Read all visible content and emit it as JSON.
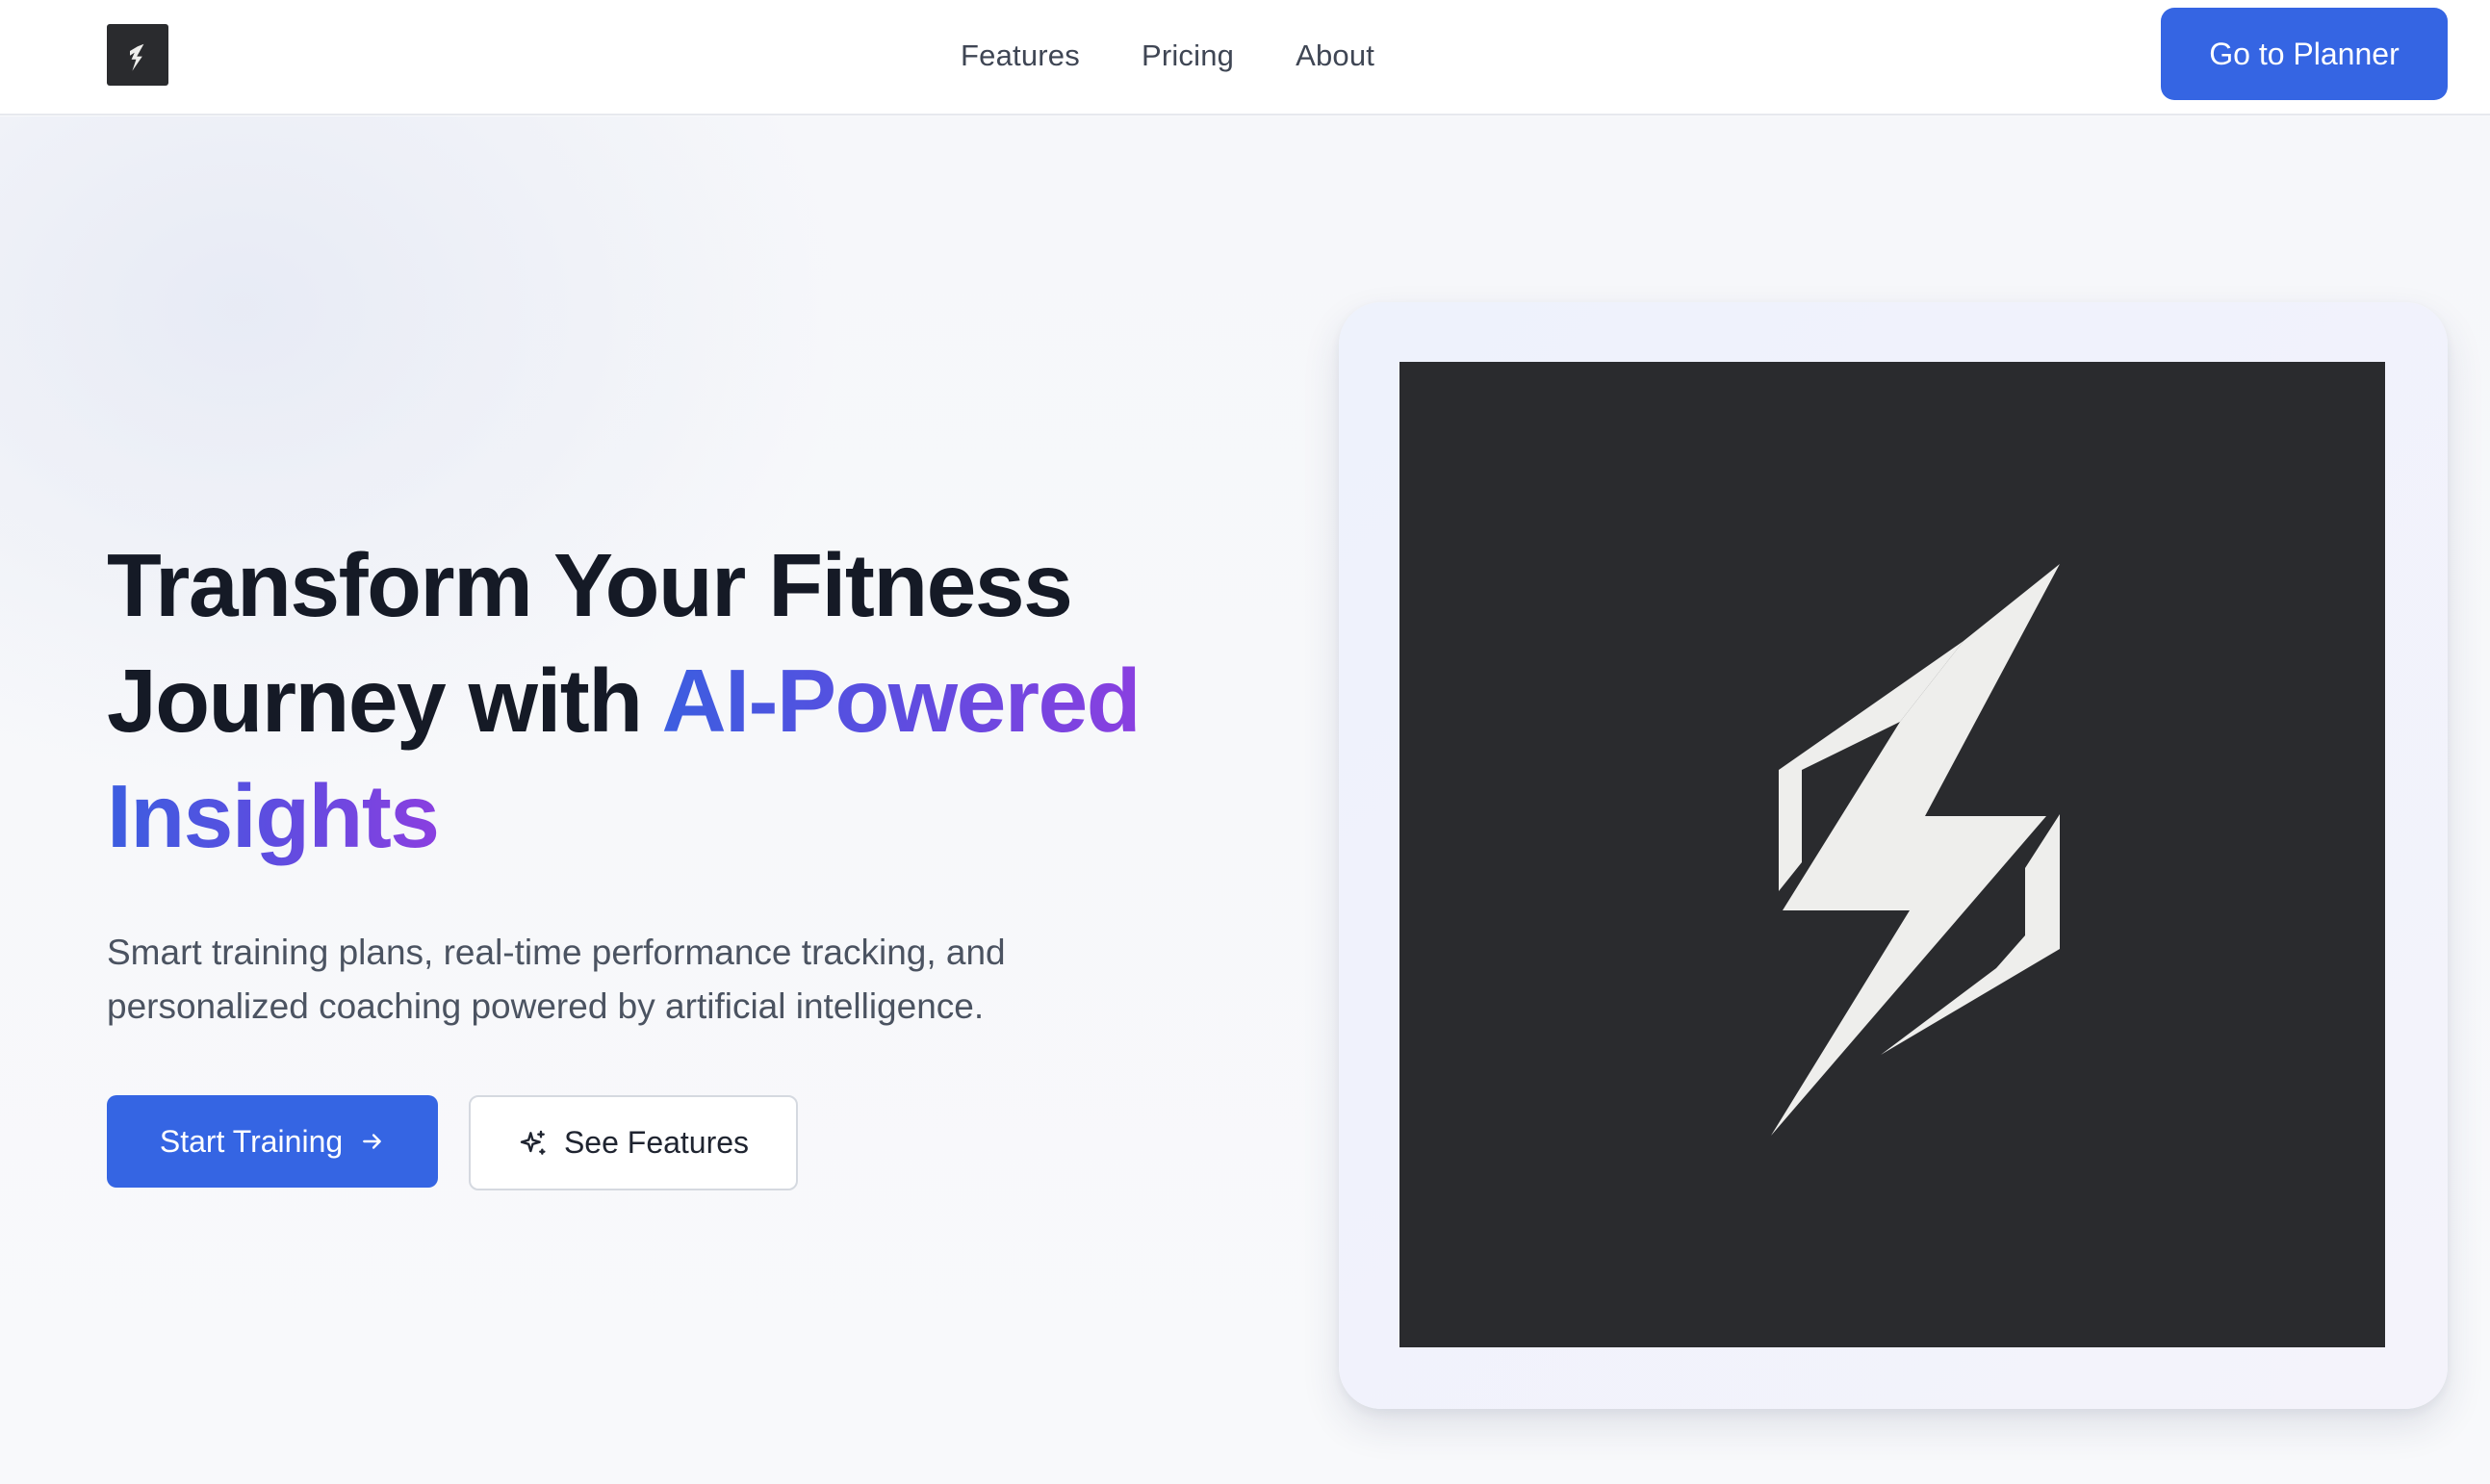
{
  "header": {
    "logo_icon": "lightning-bolt-icon",
    "nav": [
      {
        "label": "Features"
      },
      {
        "label": "Pricing"
      },
      {
        "label": "About"
      }
    ],
    "cta_label": "Go to Planner"
  },
  "hero": {
    "headline_part1": "Transform Your Fitness Journey with ",
    "headline_highlight_1": "AI-Powered",
    "headline_highlight_2": "Insights",
    "subtitle": "Smart training plans, real-time performance tracking, and personalized coaching powered by artificial intelligence.",
    "primary_button": {
      "label": "Start Training",
      "icon": "arrow-right-icon"
    },
    "secondary_button": {
      "label": "See Features",
      "icon": "sparkle-icon"
    },
    "image_icon": "lightning-bolt-icon"
  },
  "colors": {
    "brand_blue": "#3565e3",
    "gradient_start": "#3c5ee0",
    "gradient_end": "#8a3fe0",
    "logo_bg": "#2a2b2e"
  }
}
